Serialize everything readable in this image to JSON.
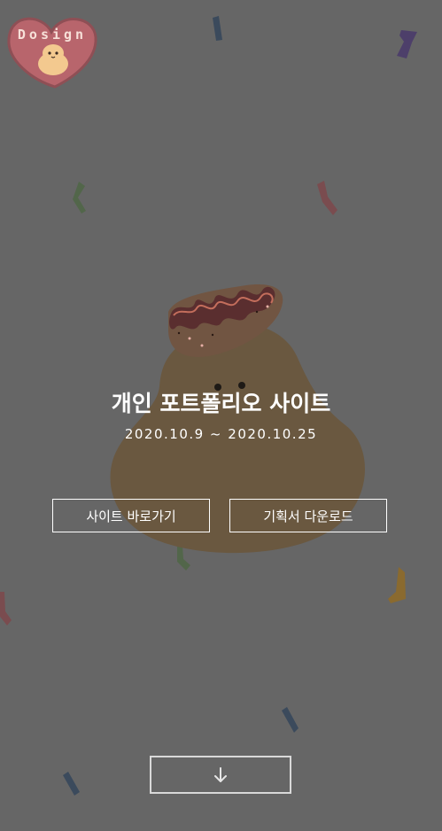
{
  "logo": {
    "text": "Dosign"
  },
  "hero": {
    "title": "개인 포트폴리오 사이트",
    "date_range": "2020.10.9 ~ 2020.10.25"
  },
  "buttons": {
    "site_label": "사이트 바로가기",
    "plan_label": "기획서 다운로드"
  },
  "scroll_down": {
    "icon": "arrow-down-icon"
  },
  "colors": {
    "background": "#666666",
    "text": "#ffffff",
    "logo_heart": "#b8656c",
    "mascot_body": "#6a5840",
    "mascot_hat": "#715542"
  }
}
